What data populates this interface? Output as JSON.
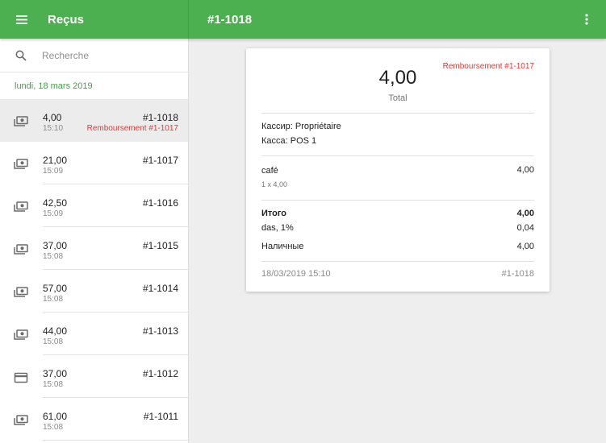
{
  "appbar": {
    "title": "Reçus",
    "receipt_title": "#1-1018",
    "color": "#4caf50"
  },
  "search": {
    "placeholder": "Recherche"
  },
  "date_header": "lundi, 18 mars 2019",
  "receipts": [
    {
      "amount": "4,00",
      "time": "15:10",
      "number": "#1-1018",
      "refund": "Remboursement #1-1017",
      "icon": "cash-icon",
      "selected": true
    },
    {
      "amount": "21,00",
      "time": "15:09",
      "number": "#1-1017",
      "icon": "cash-icon"
    },
    {
      "amount": "42,50",
      "time": "15:09",
      "number": "#1-1016",
      "icon": "cash-icon"
    },
    {
      "amount": "37,00",
      "time": "15:08",
      "number": "#1-1015",
      "icon": "cash-icon"
    },
    {
      "amount": "57,00",
      "time": "15:08",
      "number": "#1-1014",
      "icon": "cash-icon"
    },
    {
      "amount": "44,00",
      "time": "15:08",
      "number": "#1-1013",
      "icon": "cash-icon"
    },
    {
      "amount": "37,00",
      "time": "15:08",
      "number": "#1-1012",
      "icon": "card-icon"
    },
    {
      "amount": "61,00",
      "time": "15:08",
      "number": "#1-1011",
      "icon": "cash-icon"
    }
  ],
  "detail": {
    "refund_label": "Remboursement  #1-1017",
    "total_amount": "4,00",
    "total_label": "Total",
    "cashier": "Кассир: Propriétaire",
    "register": "Касса: POS 1",
    "item_name": "café",
    "item_price": "4,00",
    "item_qty": "1 x 4,00",
    "subtotal_label": "Итого",
    "subtotal_value": "4,00",
    "tax_label": "das,  1%",
    "tax_value": "0,04",
    "payment_label": "Наличные",
    "payment_value": "4,00",
    "datetime": "18/03/2019 15:10",
    "number": "#1-1018",
    "refund_color": "#e53935"
  }
}
